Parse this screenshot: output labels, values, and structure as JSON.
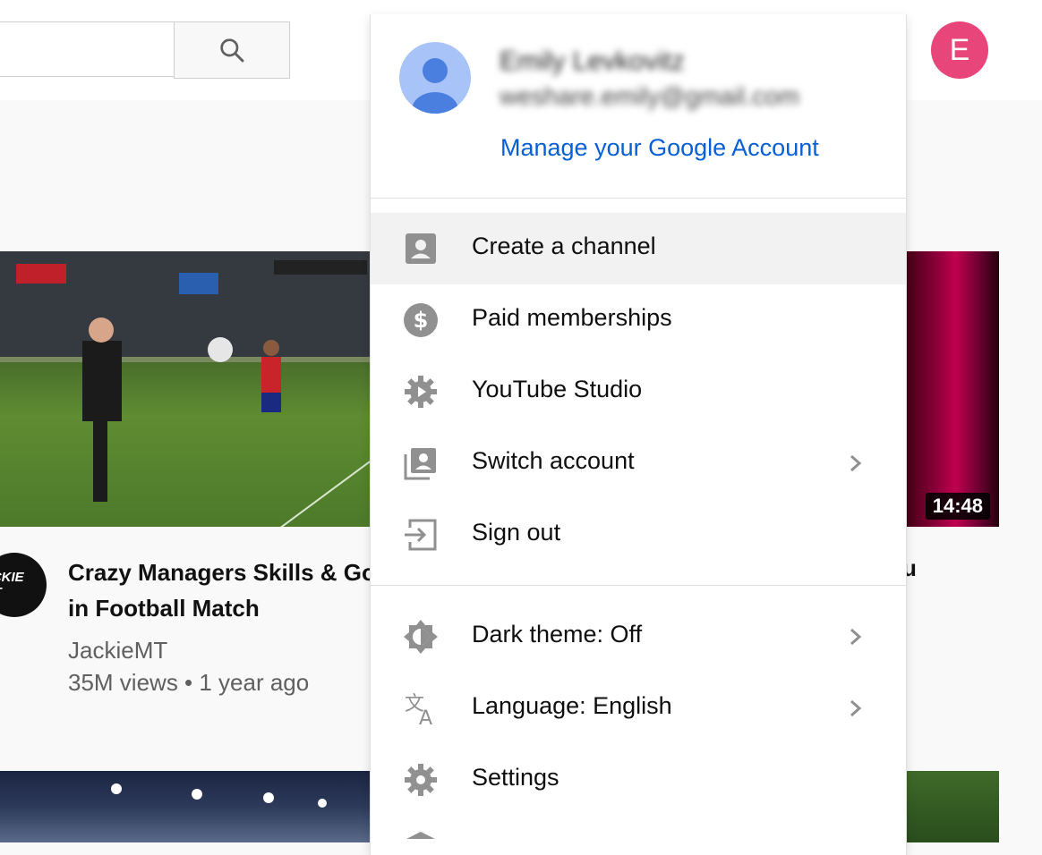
{
  "topbar": {
    "search_placeholder": "",
    "user_initial": "E"
  },
  "videos": {
    "left": {
      "duration": "",
      "channel_logo_text": "ACKIE MT",
      "title_line1": "Crazy Managers Skills & Go",
      "title_line2": "in Football Match",
      "channel": "JackieMT",
      "meta": "35M views • 1 year ago"
    },
    "right": {
      "duration": "14:48",
      "title_fragment": "u"
    }
  },
  "account_menu": {
    "name": "Emily Levkovitz",
    "email": "weshare.emily@gmail.com",
    "manage_link": "Manage your Google Account",
    "items": [
      {
        "label": "Create a channel",
        "icon": "account-box-icon",
        "chevron": false
      },
      {
        "label": "Paid memberships",
        "icon": "dollar-circle-icon",
        "chevron": false
      },
      {
        "label": "YouTube Studio",
        "icon": "studio-gear-icon",
        "chevron": false
      },
      {
        "label": "Switch account",
        "icon": "switch-account-icon",
        "chevron": true
      },
      {
        "label": "Sign out",
        "icon": "sign-out-icon",
        "chevron": false
      },
      {
        "label": "Dark theme: Off",
        "icon": "dark-theme-icon",
        "chevron": true
      },
      {
        "label": "Language: English",
        "icon": "translate-icon",
        "chevron": true
      },
      {
        "label": "Settings",
        "icon": "settings-gear-icon",
        "chevron": false
      }
    ]
  },
  "colors": {
    "accent_link": "#065fd4",
    "user_avatar": "#e8457a",
    "icon_gray": "#909090"
  }
}
